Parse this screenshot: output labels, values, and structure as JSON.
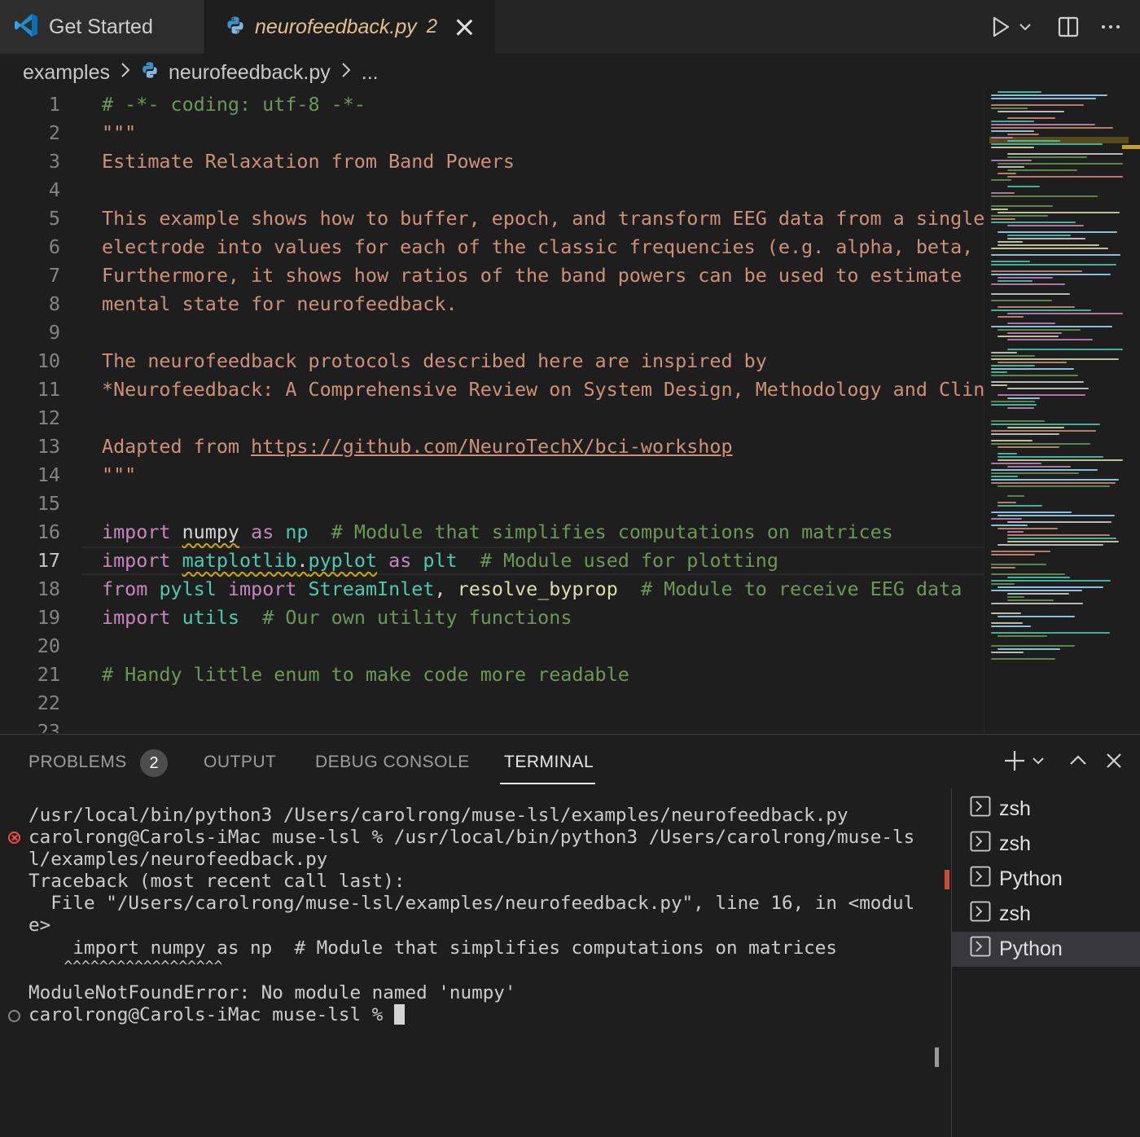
{
  "tabs": {
    "welcome_label": "Get Started",
    "file_label": "neurofeedback.py",
    "file_problem_count": "2"
  },
  "breadcrumb": {
    "folder": "examples",
    "file": "neurofeedback.py",
    "more": "..."
  },
  "editor": {
    "current_line": 17,
    "line_numbers": [
      "1",
      "2",
      "3",
      "4",
      "5",
      "6",
      "7",
      "8",
      "9",
      "10",
      "11",
      "12",
      "13",
      "14",
      "15",
      "16",
      "17",
      "18",
      "19",
      "20",
      "21",
      "22",
      "23"
    ],
    "lines": {
      "l1": "# -*- coding: utf-8 -*-",
      "l2": "\"\"\"",
      "l3": "Estimate Relaxation from Band Powers",
      "l5": "This example shows how to buffer, epoch, and transform EEG data from a single",
      "l6": "electrode into values for each of the classic frequencies (e.g. alpha, beta,",
      "l7": "Furthermore, it shows how ratios of the band powers can be used to estimate",
      "l8": "mental state for neurofeedback.",
      "l10": "The neurofeedback protocols described here are inspired by",
      "l11": "*Neurofeedback: A Comprehensive Review on System Design, Methodology and Clin",
      "l13_prefix": "Adapted from ",
      "l13_link": "https://github.com/NeuroTechX/bci-workshop",
      "l14": "\"\"\"",
      "l16": {
        "kw1": "import",
        "mod": "numpy",
        "kw2": "as",
        "alias": "np",
        "comment": "# Module that simplifies computations on matrices"
      },
      "l17": {
        "kw1": "import",
        "mod1": "matplotlib",
        "dot": ".",
        "mod2": "pyplot",
        "kw2": "as",
        "alias": "plt",
        "comment": "# Module used for plotting"
      },
      "l18": {
        "kw1": "from",
        "mod": "pylsl",
        "kw2": "import",
        "cls": "StreamInlet",
        "comma": ",",
        "fn": "resolve_byprop",
        "comment": "# Module to receive EEG data"
      },
      "l19": {
        "kw1": "import",
        "mod": "utils",
        "comment": "# Our own utility functions"
      },
      "l21": "# Handy little enum to make code more readable"
    }
  },
  "panel": {
    "tabs": [
      "PROBLEMS",
      "OUTPUT",
      "DEBUG CONSOLE",
      "TERMINAL"
    ],
    "problems_count": "2",
    "active_tab": "TERMINAL"
  },
  "terminal": {
    "lines": [
      "/usr/local/bin/python3 /Users/carolrong/muse-lsl/examples/neurofeedback.py",
      "carolrong@Carols-iMac muse-lsl % /usr/local/bin/python3 /Users/carolrong/muse-ls",
      "l/examples/neurofeedback.py",
      "Traceback (most recent call last):",
      "  File \"/Users/carolrong/muse-lsl/examples/neurofeedback.py\", line 16, in <modul",
      "e>",
      "    import numpy as np  # Module that simplifies computations on matrices",
      "    ^^^^^^^^^^^^^^^^^^",
      "ModuleNotFoundError: No module named 'numpy'",
      "carolrong@Carols-iMac muse-lsl % "
    ],
    "sessions": [
      "zsh",
      "zsh",
      "Python",
      "zsh",
      "Python"
    ],
    "selected_session_index": 4
  },
  "colors": {
    "comment": "#6a9955",
    "string": "#ce9178",
    "keyword": "#c586c0",
    "module": "#4ec9b0",
    "function": "#dcdcaa",
    "variable": "#9cdcfe",
    "warning_squiggle": "#cca700",
    "modified_tab": "#e2c08d",
    "error": "#f14c4c"
  },
  "icons": [
    "vscode-logo-icon",
    "python-file-icon",
    "close-icon",
    "run-icon",
    "chevron-down-icon",
    "split-editor-icon",
    "more-actions-icon",
    "chevron-right-icon",
    "plus-icon",
    "chevron-up-icon",
    "terminal-icon",
    "error-circle-icon",
    "circle-icon"
  ]
}
